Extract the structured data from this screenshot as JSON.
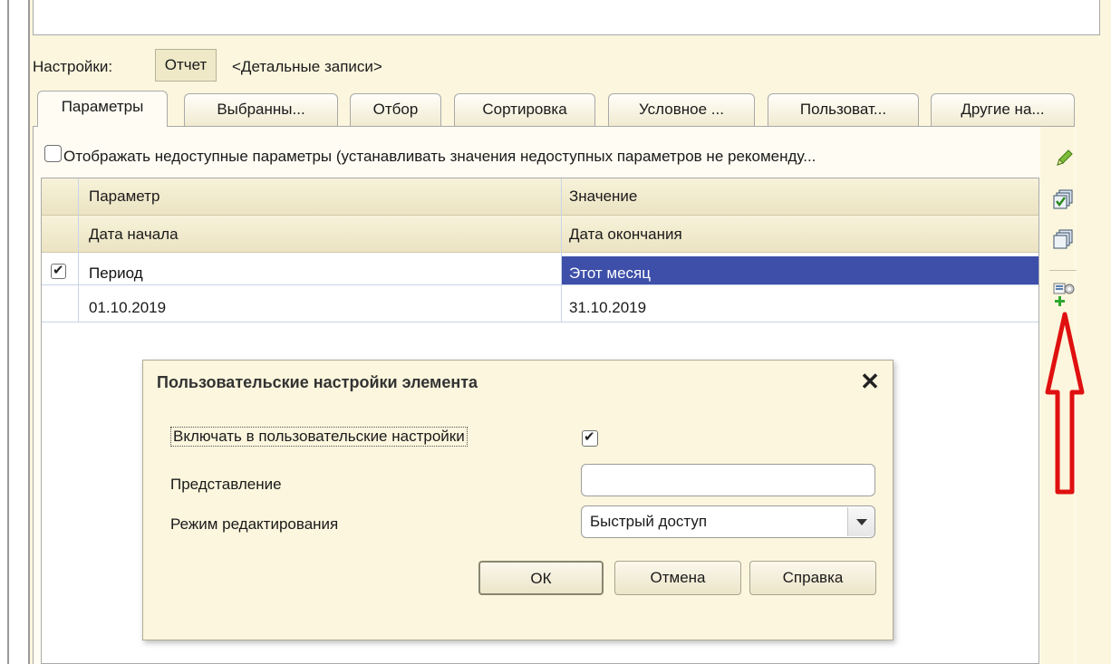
{
  "settings": {
    "label": "Настройки:",
    "report_button": "Отчет",
    "detail_records": "<Детальные записи>"
  },
  "tabs": [
    {
      "label": "Параметры",
      "active": true
    },
    {
      "label": "Выбранны...",
      "active": false
    },
    {
      "label": "Отбор",
      "active": false
    },
    {
      "label": "Сортировка",
      "active": false
    },
    {
      "label": "Условное ...",
      "active": false
    },
    {
      "label": "Пользоват...",
      "active": false
    },
    {
      "label": "Другие на...",
      "active": false
    }
  ],
  "show_unavailable": {
    "checked": false,
    "label": "Отображать недоступные параметры (устанавливать значения недоступных параметров не рекоменду..."
  },
  "table": {
    "headers_row1": [
      "Параметр",
      "Значение"
    ],
    "headers_row2": [
      "Дата начала",
      "Дата окончания"
    ],
    "rows": [
      {
        "checked": true,
        "parameter": "Период",
        "value": "Этот месяц",
        "start": "01.10.2019",
        "end": "31.10.2019"
      }
    ]
  },
  "toolbar_icons": [
    "pencil-icon",
    "check-all-icon",
    "uncheck-all-icon",
    "element-user-settings-icon"
  ],
  "dialog": {
    "title": "Пользовательские настройки элемента",
    "close": "✕",
    "include_label": "Включать в пользовательские настройки",
    "include_checked": true,
    "presentation_label": "Представление",
    "presentation_value": "",
    "mode_label": "Режим редактирования",
    "mode_value": "Быстрый доступ",
    "buttons": {
      "ok": "ОК",
      "cancel": "Отмена",
      "help": "Справка"
    }
  },
  "colors": {
    "panel_bg": "#fbf6dd",
    "selection": "#3d4fa9",
    "annotation_arrow": "#e01010"
  }
}
